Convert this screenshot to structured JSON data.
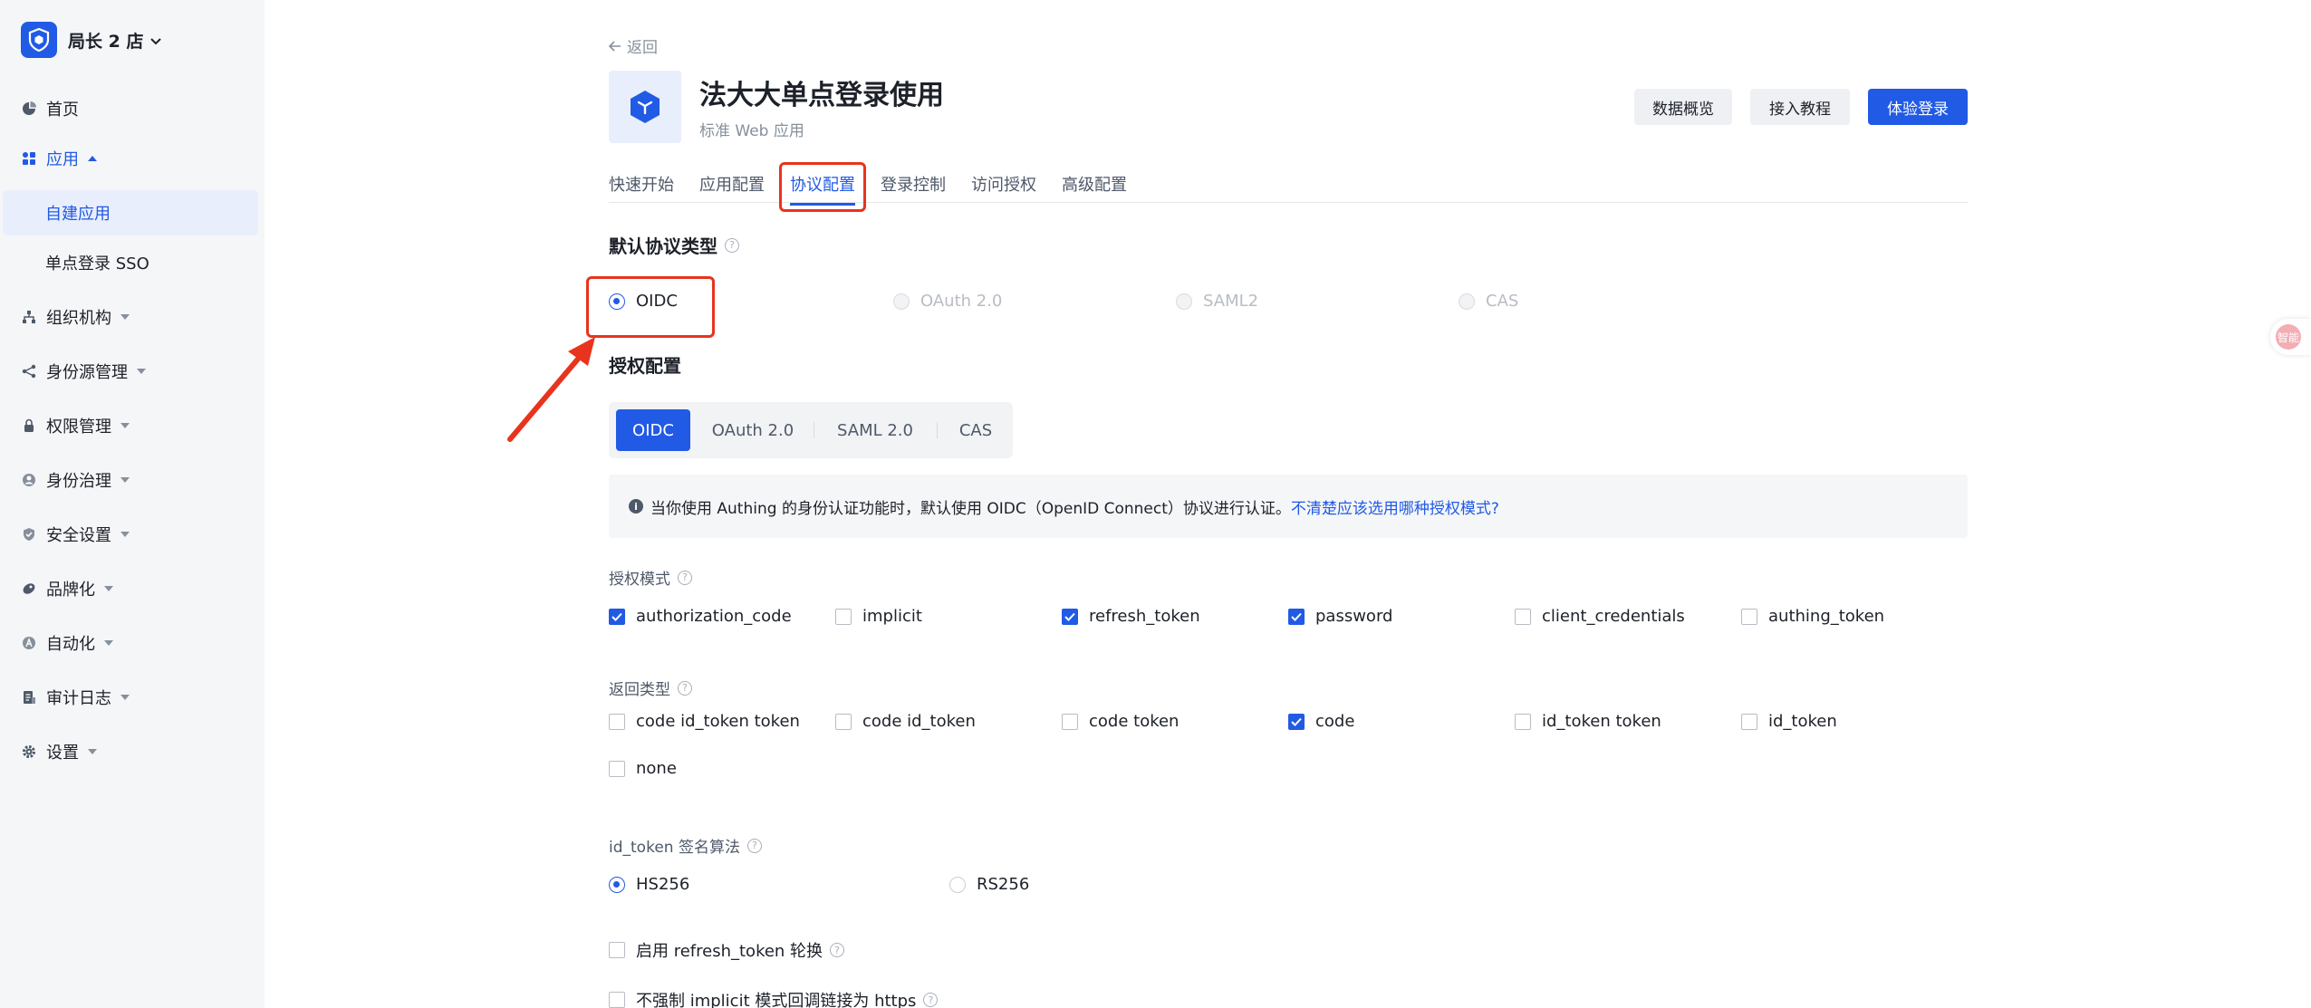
{
  "sidebar": {
    "org_name": "局长 2 店",
    "items": [
      {
        "label": "首页",
        "icon": "pie-chart-icon"
      },
      {
        "label": "应用",
        "icon": "apps-icon"
      },
      {
        "label": "组织机构",
        "icon": "org-tree-icon"
      },
      {
        "label": "身份源管理",
        "icon": "share-icon"
      },
      {
        "label": "权限管理",
        "icon": "lock-icon"
      },
      {
        "label": "身份治理",
        "icon": "user-circle-icon"
      },
      {
        "label": "安全设置",
        "icon": "shield-icon"
      },
      {
        "label": "品牌化",
        "icon": "brush-icon"
      },
      {
        "label": "自动化",
        "icon": "automation-icon"
      },
      {
        "label": "审计日志",
        "icon": "log-icon"
      },
      {
        "label": "设置",
        "icon": "gear-icon"
      }
    ],
    "sub_items": [
      {
        "label": "自建应用"
      },
      {
        "label": "单点登录 SSO"
      }
    ]
  },
  "header": {
    "back_label": "返回",
    "app_title": "法大大单点登录使用",
    "app_subtitle": "标准 Web 应用",
    "buttons": {
      "overview": "数据概览",
      "tutorial": "接入教程",
      "try_login": "体验登录"
    }
  },
  "tabs": [
    "快速开始",
    "应用配置",
    "协议配置",
    "登录控制",
    "访问授权",
    "高级配置"
  ],
  "active_tab": "协议配置",
  "default_protocol": {
    "title": "默认协议类型",
    "options": [
      "OIDC",
      "OAuth 2.0",
      "SAML2",
      "CAS"
    ],
    "selected": "OIDC"
  },
  "auth_config": {
    "title": "授权配置",
    "segments": [
      "OIDC",
      "OAuth 2.0",
      "SAML 2.0",
      "CAS"
    ],
    "active_segment": "OIDC",
    "info_text": "当你使用 Authing 的身份认证功能时，默认使用 OIDC（OpenID Connect）协议进行认证。",
    "info_link": "不清楚应该选用哪种授权模式?"
  },
  "grant_types": {
    "label": "授权模式",
    "options": [
      {
        "label": "authorization_code",
        "checked": true
      },
      {
        "label": "implicit",
        "checked": false
      },
      {
        "label": "refresh_token",
        "checked": true
      },
      {
        "label": "password",
        "checked": true
      },
      {
        "label": "client_credentials",
        "checked": false
      },
      {
        "label": "authing_token",
        "checked": false
      }
    ]
  },
  "response_types": {
    "label": "返回类型",
    "options": [
      {
        "label": "code id_token token",
        "checked": false
      },
      {
        "label": "code id_token",
        "checked": false
      },
      {
        "label": "code token",
        "checked": false
      },
      {
        "label": "code",
        "checked": true
      },
      {
        "label": "id_token token",
        "checked": false
      },
      {
        "label": "id_token",
        "checked": false
      },
      {
        "label": "none",
        "checked": false
      }
    ]
  },
  "signing": {
    "label": "id_token 签名算法",
    "options": [
      "HS256",
      "RS256"
    ],
    "selected": "HS256"
  },
  "extra_options": [
    {
      "label": "启用 refresh_token 轮换",
      "checked": false
    },
    {
      "label": "不强制 implicit 模式回调链接为 https",
      "checked": false
    }
  ],
  "float_button_label": "智能",
  "colors": {
    "primary": "#215ae5",
    "highlight": "#e8341c",
    "sidebar_bg": "#f5f6f8"
  }
}
